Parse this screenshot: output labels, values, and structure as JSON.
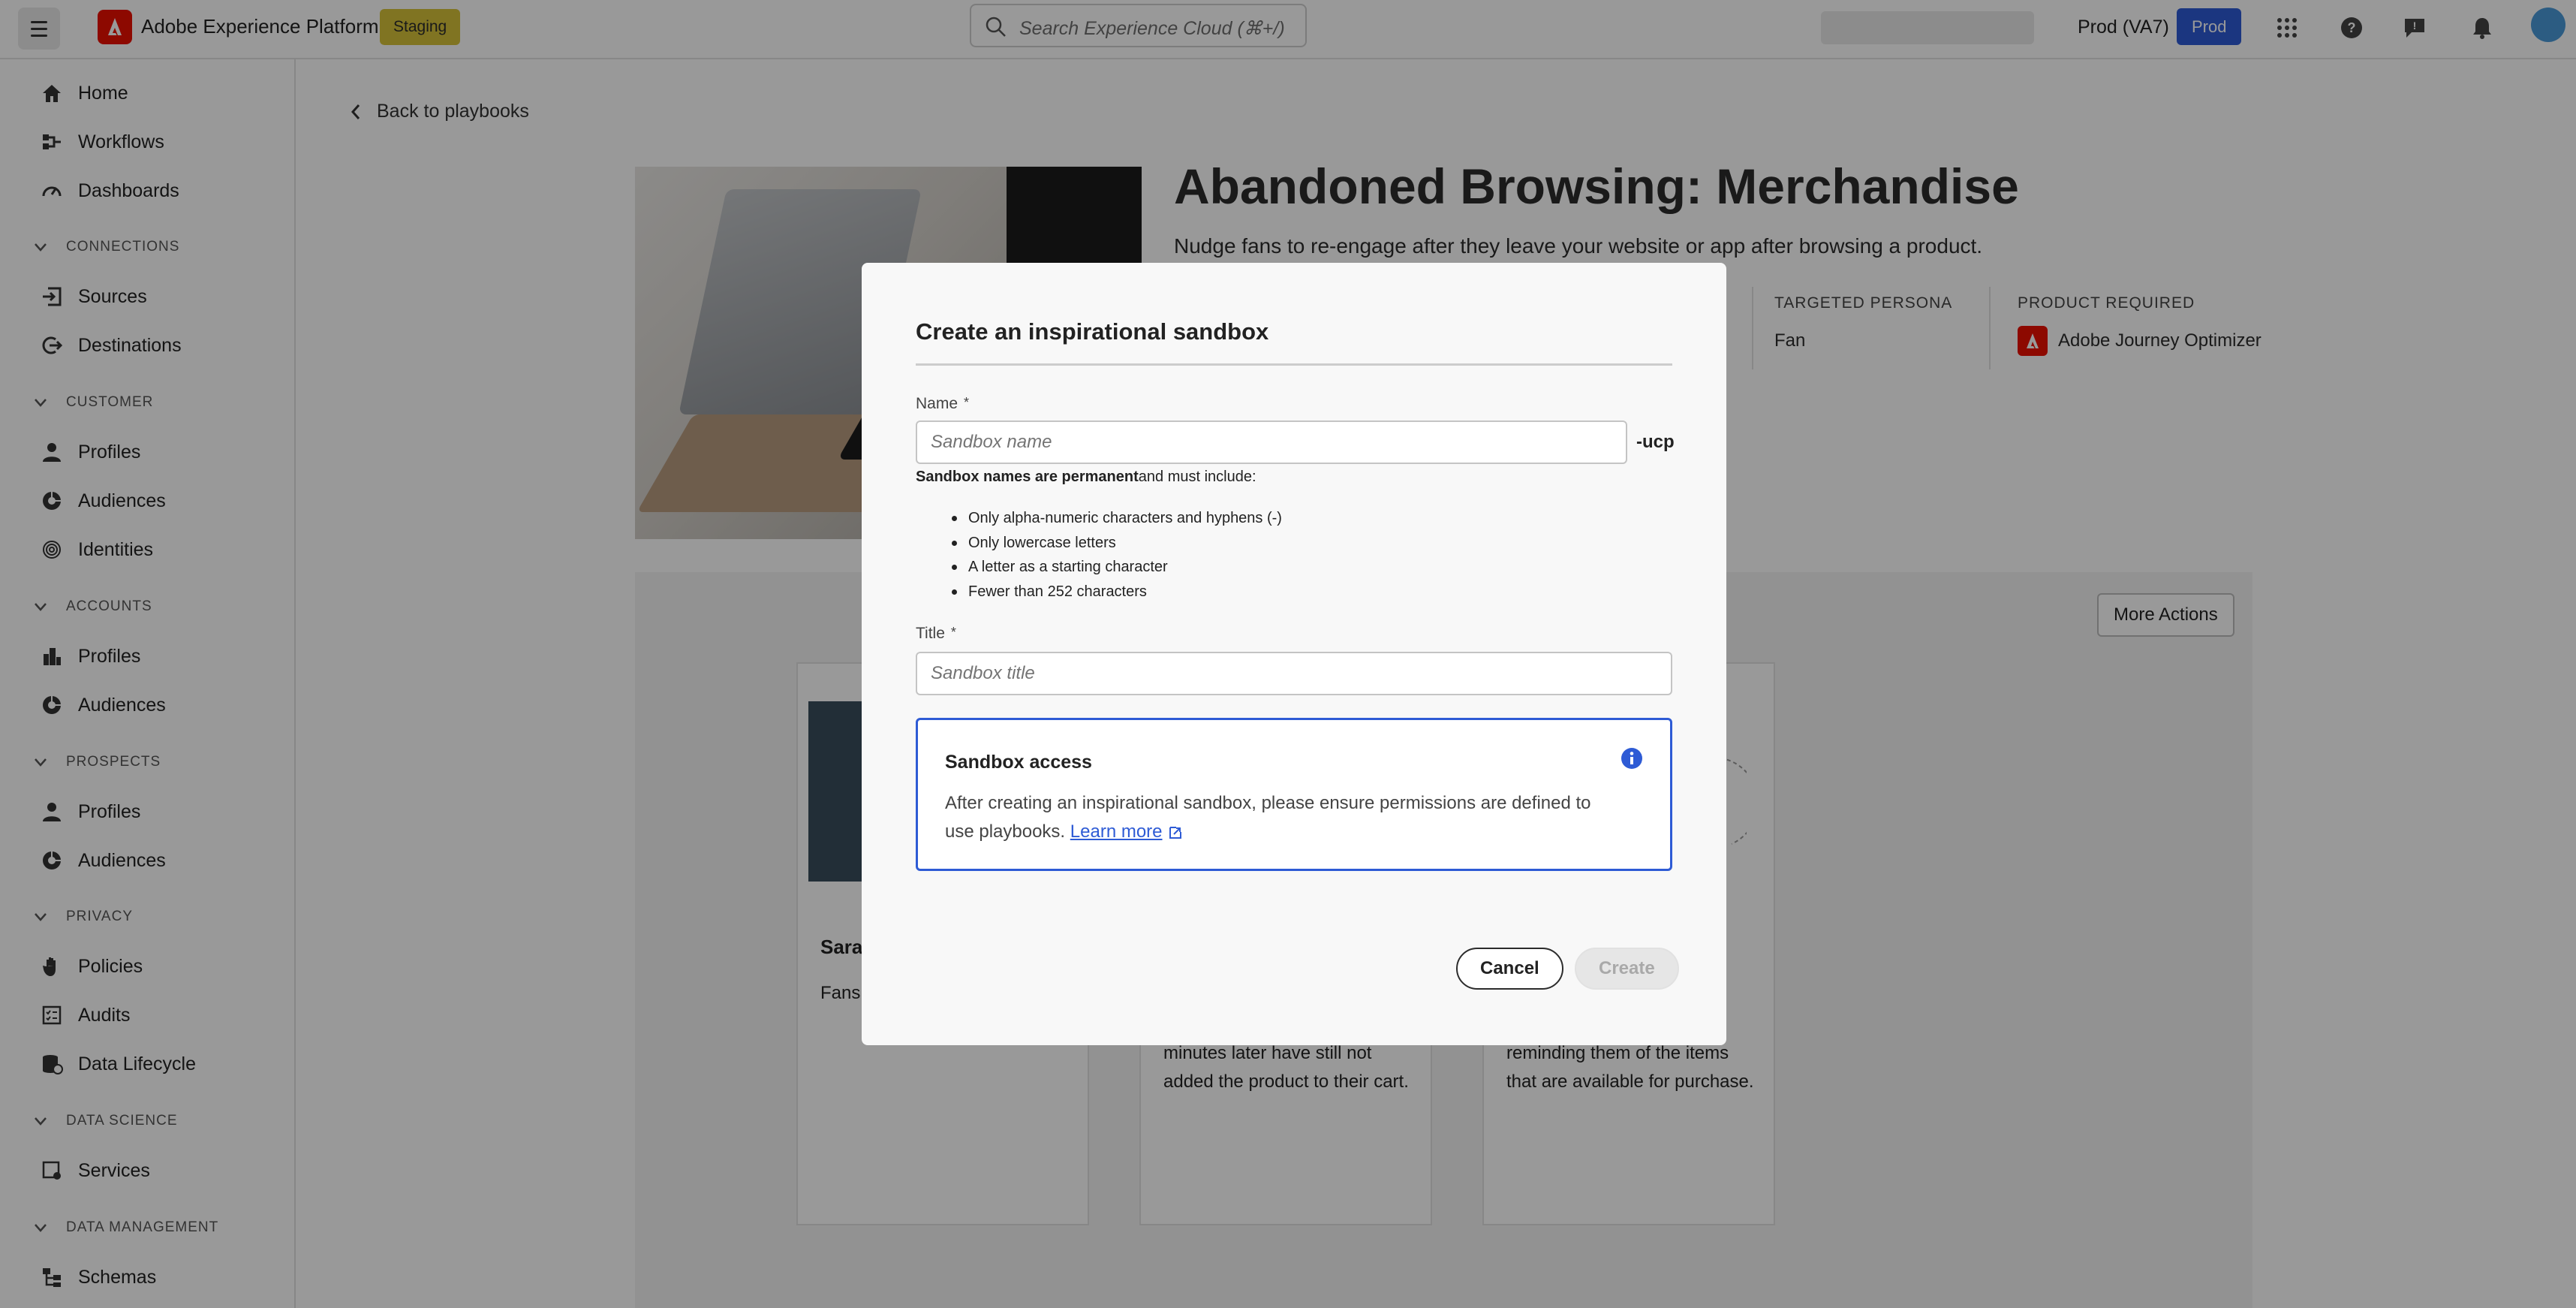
{
  "topbar": {
    "app_name": "Adobe Experience Platform",
    "env_badge": "Staging",
    "search_placeholder": "Search Experience Cloud (⌘+/)",
    "org_name": "Prod (VA7)",
    "prod_badge": "Prod",
    "icons": [
      "apps-grid-icon",
      "help-icon",
      "feedback-icon",
      "notifications-bell-icon"
    ]
  },
  "sidebar": {
    "items": [
      {
        "label": "Home",
        "icon": "home-icon"
      },
      {
        "label": "Workflows",
        "icon": "workflows-icon"
      },
      {
        "label": "Dashboards",
        "icon": "dashboards-icon"
      }
    ],
    "sections": [
      {
        "title": "CONNECTIONS",
        "items": [
          {
            "label": "Sources",
            "icon": "sources-icon"
          },
          {
            "label": "Destinations",
            "icon": "destinations-icon"
          }
        ]
      },
      {
        "title": "CUSTOMER",
        "items": [
          {
            "label": "Profiles",
            "icon": "person-icon"
          },
          {
            "label": "Audiences",
            "icon": "audiences-icon"
          },
          {
            "label": "Identities",
            "icon": "fingerprint-icon"
          }
        ]
      },
      {
        "title": "ACCOUNTS",
        "items": [
          {
            "label": "Profiles",
            "icon": "building-icon"
          },
          {
            "label": "Audiences",
            "icon": "audiences-icon"
          }
        ]
      },
      {
        "title": "PROSPECTS",
        "items": [
          {
            "label": "Profiles",
            "icon": "person-icon"
          },
          {
            "label": "Audiences",
            "icon": "audiences-icon"
          }
        ]
      },
      {
        "title": "PRIVACY",
        "items": [
          {
            "label": "Policies",
            "icon": "hand-icon"
          },
          {
            "label": "Audits",
            "icon": "audits-icon"
          },
          {
            "label": "Data Lifecycle",
            "icon": "data-lifecycle-icon"
          }
        ]
      },
      {
        "title": "DATA SCIENCE",
        "items": [
          {
            "label": "Services",
            "icon": "services-icon"
          }
        ]
      },
      {
        "title": "DATA MANAGEMENT",
        "items": [
          {
            "label": "Schemas",
            "icon": "schemas-icon"
          }
        ]
      }
    ]
  },
  "page": {
    "back_link": "Back to playbooks",
    "title": "Abandoned Browsing: Merchandise",
    "description": "Nudge fans to re-engage after they leave your website or app after browsing a product.",
    "targeted_persona_label": "TARGETED PERSONA",
    "targeted_persona_value": "Fan",
    "product_required_label": "PRODUCT REQUIRED",
    "product_required_value": "Adobe Journey Optimizer",
    "more_actions": "More Actions",
    "cards": [
      {
        "title": "Sara",
        "text_lines": [
          "Fans"
        ]
      },
      {
        "title": "",
        "text_lines": [
          "minutes later have still not",
          "added the product to their cart."
        ]
      },
      {
        "title": "",
        "text_lines": [
          "reminding them of the items",
          "that are available for purchase."
        ]
      }
    ]
  },
  "modal": {
    "title": "Create an inspirational sandbox",
    "name_label": "Name",
    "name_placeholder": "Sandbox name",
    "name_value": "",
    "name_suffix": "-ucp",
    "help_bold": "Sandbox names are permanent",
    "help_rest": "and must include:",
    "rules": [
      "Only alpha-numeric characters and hyphens (-)",
      "Only lowercase letters",
      "A letter as a starting character",
      "Fewer than 252 characters"
    ],
    "title_label": "Title",
    "title_placeholder": "Sandbox title",
    "title_value": "",
    "required_mark": "*",
    "info_title": "Sandbox access",
    "info_text": "After creating an inspirational sandbox, please ensure permissions are defined to use playbooks.",
    "learn_more": "Learn more",
    "cancel_label": "Cancel",
    "create_label": "Create"
  },
  "colors": {
    "accent_blue": "#2e5bd5",
    "adobe_red": "#eb1000",
    "staging_yellow": "#d6c23a"
  }
}
